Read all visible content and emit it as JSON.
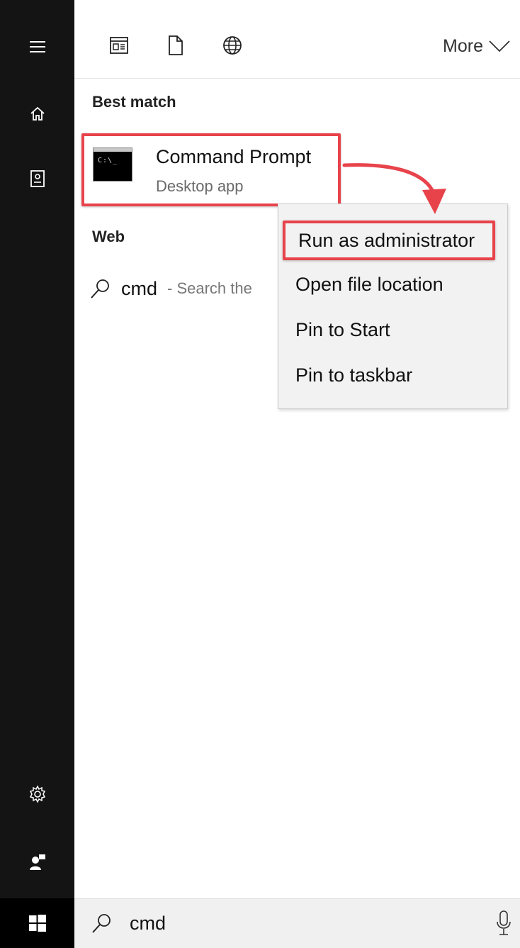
{
  "toolbar": {
    "icons": [
      "apps-filter-icon",
      "documents-filter-icon",
      "web-filter-icon"
    ],
    "more_label": "More"
  },
  "sections": {
    "best_match": "Best match",
    "web": "Web"
  },
  "best_match_item": {
    "title": "Command Prompt",
    "subtitle": "Desktop app",
    "icon_text": "C:\\_"
  },
  "web_result": {
    "query": "cmd",
    "hint": "- Search the"
  },
  "context_menu": {
    "items": [
      "Run as administrator",
      "Open file location",
      "Pin to Start",
      "Pin to taskbar"
    ]
  },
  "search": {
    "value": "cmd"
  },
  "colors": {
    "rail": "#141414",
    "highlight": "#e8434b",
    "menu_bg": "#f2f2f2"
  }
}
